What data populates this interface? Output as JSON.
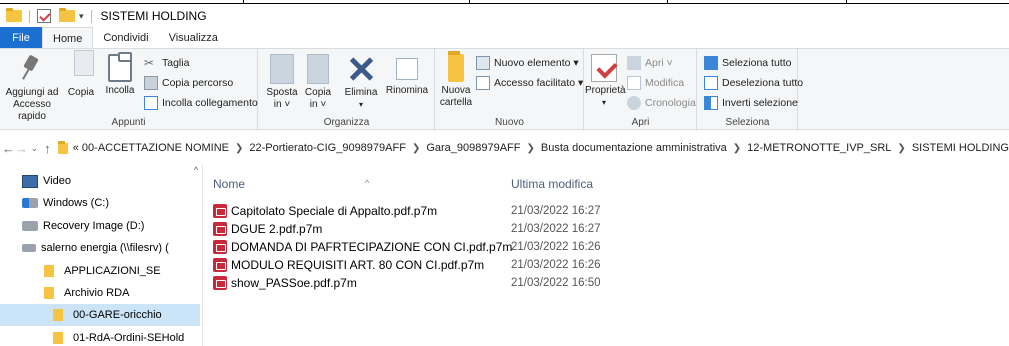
{
  "window": {
    "title": "SISTEMI HOLDING"
  },
  "ribbon_tabs": [
    "File",
    "Home",
    "Condividi",
    "Visualizza"
  ],
  "ribbon": {
    "appunti": {
      "label": "Appunti",
      "pin": [
        "Aggiungi ad",
        "Accesso rapido"
      ],
      "copy": "Copia",
      "paste": "Incolla",
      "cut": "Taglia",
      "copy_path": "Copia percorso",
      "paste_shortcut": "Incolla collegamento"
    },
    "organizza": {
      "label": "Organizza",
      "move": [
        "Sposta",
        "in ˅"
      ],
      "copy": [
        "Copia",
        "in ˅"
      ],
      "delete": "Elimina",
      "rename": "Rinomina"
    },
    "nuovo": {
      "label": "Nuovo",
      "new_folder": [
        "Nuova",
        "cartella"
      ],
      "new_item": "Nuovo elemento ▾",
      "easy_access": "Accesso facilitato ▾"
    },
    "apri": {
      "label": "Apri",
      "properties": "Proprietà",
      "open": "Apri ˅",
      "edit": "Modifica",
      "history": "Cronologia"
    },
    "seleziona": {
      "label": "Seleziona",
      "select_all": "Seleziona tutto",
      "select_none": "Deseleziona tutto",
      "invert": "Inverti selezione"
    }
  },
  "address": {
    "crumbs": [
      "« 00-ACCETTAZIONE NOMINE",
      "22-Portierato-CIG_9098979AFF",
      "Gara_9098979AFF",
      "Busta documentazione amministrativa",
      "12-METRONOTTE_IVP_SRL",
      "SISTEMI HOLDING"
    ]
  },
  "nav_pane": [
    "Video",
    "Windows (C:)",
    "Recovery Image (D:)",
    "salerno energia (\\\\filesrv) (",
    "APPLICAZIONI_SE",
    "Archivio RDA",
    "00-GARE-oricchio",
    "01-RdA-Ordini-SEHold"
  ],
  "file_list": {
    "columns": [
      "Nome",
      "Ultima modifica"
    ],
    "files": [
      {
        "name": "Capitolato Speciale di Appalto.pdf.p7m",
        "modified": "21/03/2022 16:27"
      },
      {
        "name": "DGUE 2.pdf.p7m",
        "modified": "21/03/2022 16:27"
      },
      {
        "name": "DOMANDA DI PAFRTECIPAZIONE CON CI.pdf.p7m",
        "modified": "21/03/2022 16:26"
      },
      {
        "name": "MODULO REQUISITI ART. 80 CON CI.pdf.p7m",
        "modified": "21/03/2022 16:26"
      },
      {
        "name": "show_PASSoe.pdf.p7m",
        "modified": "21/03/2022 16:50"
      }
    ]
  }
}
